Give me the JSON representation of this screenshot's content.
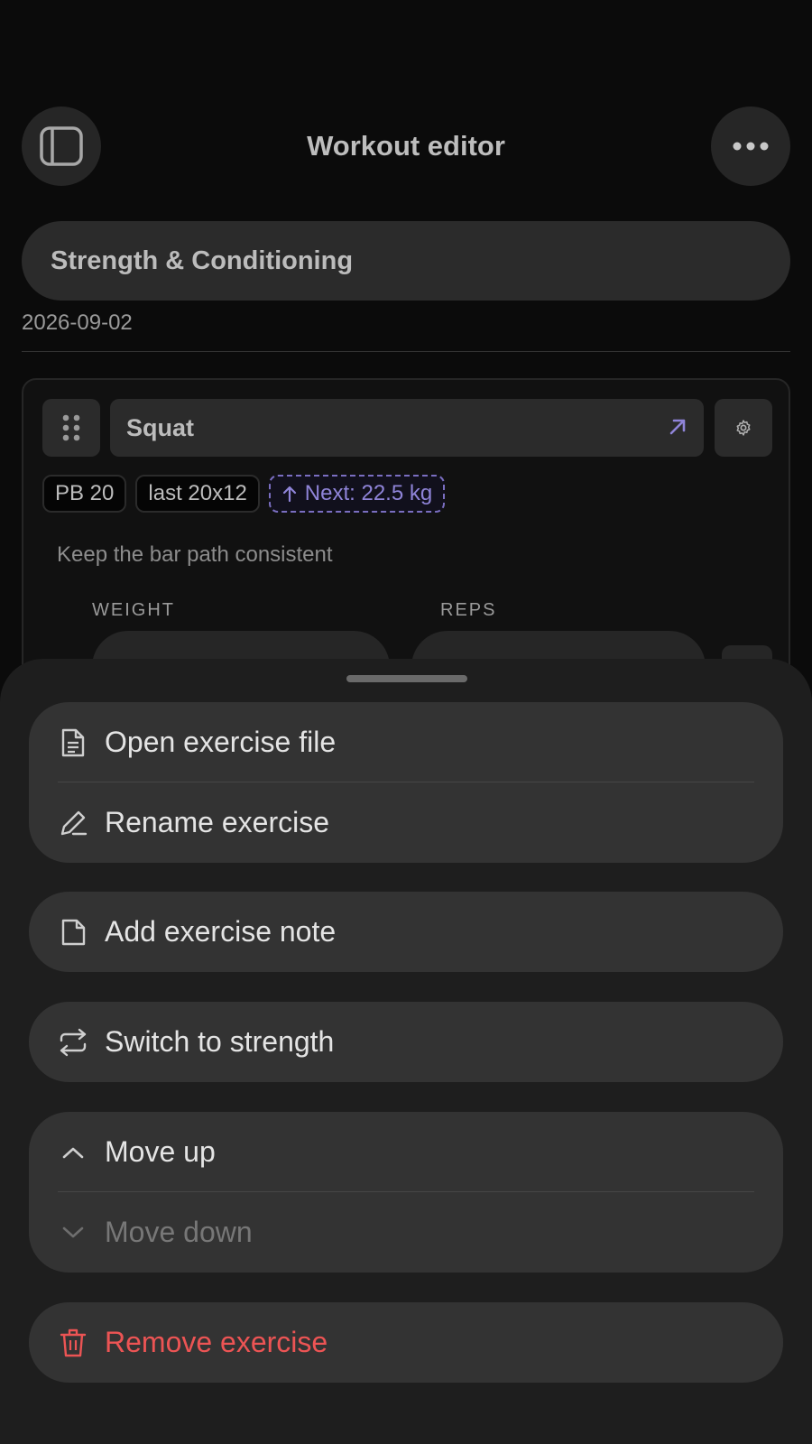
{
  "header": {
    "title": "Workout editor"
  },
  "workout": {
    "name": "Strength & Conditioning",
    "date": "2026-09-02"
  },
  "exercise": {
    "name": "Squat",
    "chips": {
      "pb": "PB 20",
      "last": "last 20x12",
      "next": "Next: 22.5 kg"
    },
    "note": "Keep the bar path consistent",
    "columns": {
      "weight": "WEIGHT",
      "reps": "REPS"
    }
  },
  "sheet": {
    "open_file": "Open exercise file",
    "rename": "Rename exercise",
    "add_note": "Add exercise note",
    "switch_type": "Switch to strength",
    "move_up": "Move up",
    "move_down": "Move down",
    "remove": "Remove exercise"
  },
  "colors": {
    "accent": "#8f84d8",
    "danger": "#ec5454"
  }
}
